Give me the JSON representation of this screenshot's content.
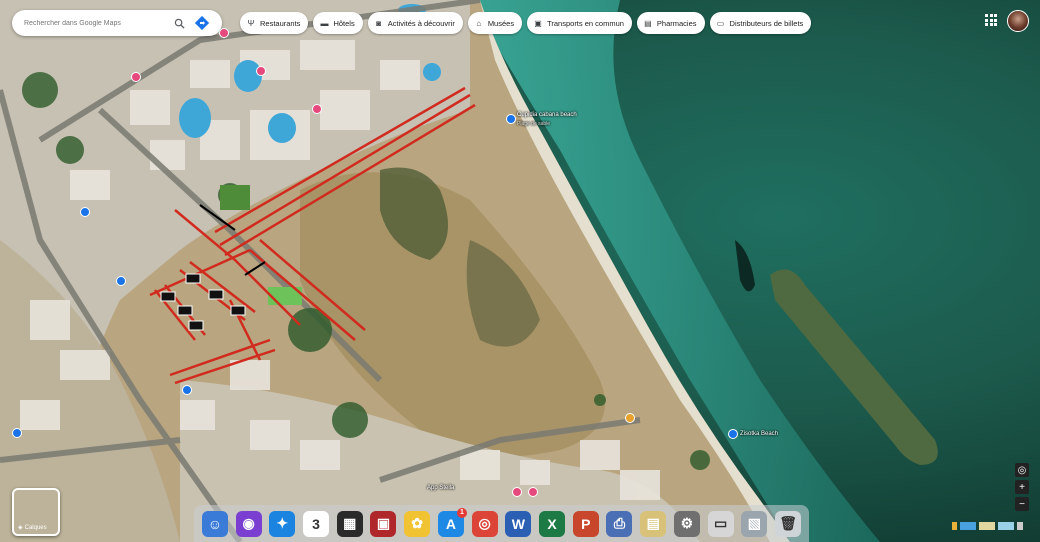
{
  "search": {
    "placeholder": "Rechercher dans Google Maps",
    "search_icon": "search-icon",
    "directions_icon": "directions-icon"
  },
  "chips": [
    {
      "label": "Restaurants",
      "icon": "fork-knife-icon"
    },
    {
      "label": "Hôtels",
      "icon": "bed-icon"
    },
    {
      "label": "Activités à découvrir",
      "icon": "camera-icon"
    },
    {
      "label": "Musées",
      "icon": "museum-icon"
    },
    {
      "label": "Transports en commun",
      "icon": "train-icon"
    },
    {
      "label": "Pharmacies",
      "icon": "pill-icon"
    },
    {
      "label": "Distributeurs de billets",
      "icon": "atm-icon"
    }
  ],
  "map_labels": [
    {
      "text": "Cupidia cabana beach"
    },
    {
      "text": "Plage de sable"
    },
    {
      "text": "Zisotka Beach"
    },
    {
      "text": "App Stella"
    }
  ],
  "layers": {
    "label": "Calques"
  },
  "zoom": {
    "in": "+",
    "out": "−"
  },
  "dock": [
    {
      "name": "finder-icon",
      "glyph": "☺",
      "color": "#3b7bd8"
    },
    {
      "name": "siri-icon",
      "glyph": "◉",
      "color": "#7a3fd0"
    },
    {
      "name": "safari-icon",
      "glyph": "✦",
      "color": "#1b84e0"
    },
    {
      "name": "calendar-icon",
      "glyph": "3",
      "color": "#ffffff"
    },
    {
      "name": "mission-control-icon",
      "glyph": "▦",
      "color": "#2a2a2a"
    },
    {
      "name": "photo-booth-icon",
      "glyph": "▣",
      "color": "#b0272b"
    },
    {
      "name": "photos-icon",
      "glyph": "✿",
      "color": "#f1c232"
    },
    {
      "name": "app-store-icon",
      "glyph": "A",
      "color": "#1e88e5"
    },
    {
      "name": "chrome-icon",
      "glyph": "◎",
      "color": "#db4437"
    },
    {
      "name": "word-icon",
      "glyph": "W",
      "color": "#2b5fb4"
    },
    {
      "name": "excel-icon",
      "glyph": "X",
      "color": "#1e7a45"
    },
    {
      "name": "powerpoint-icon",
      "glyph": "P",
      "color": "#c8462b"
    },
    {
      "name": "preview-icon",
      "glyph": "⎙",
      "color": "#4a6fb5"
    },
    {
      "name": "notes-icon",
      "glyph": "▤",
      "color": "#d8c27a"
    },
    {
      "name": "settings-icon",
      "glyph": "⚙",
      "color": "#6f6f6f"
    },
    {
      "name": "stickies-icon",
      "glyph": "▭",
      "color": "#d6d6d6"
    },
    {
      "name": "image-capture-icon",
      "glyph": "▧",
      "color": "#9aa5ad"
    },
    {
      "name": "trash-icon",
      "glyph": "🗑",
      "color": "#cfd4d8"
    }
  ],
  "dock_badge": {
    "app": "app-store-icon",
    "count": "1"
  }
}
